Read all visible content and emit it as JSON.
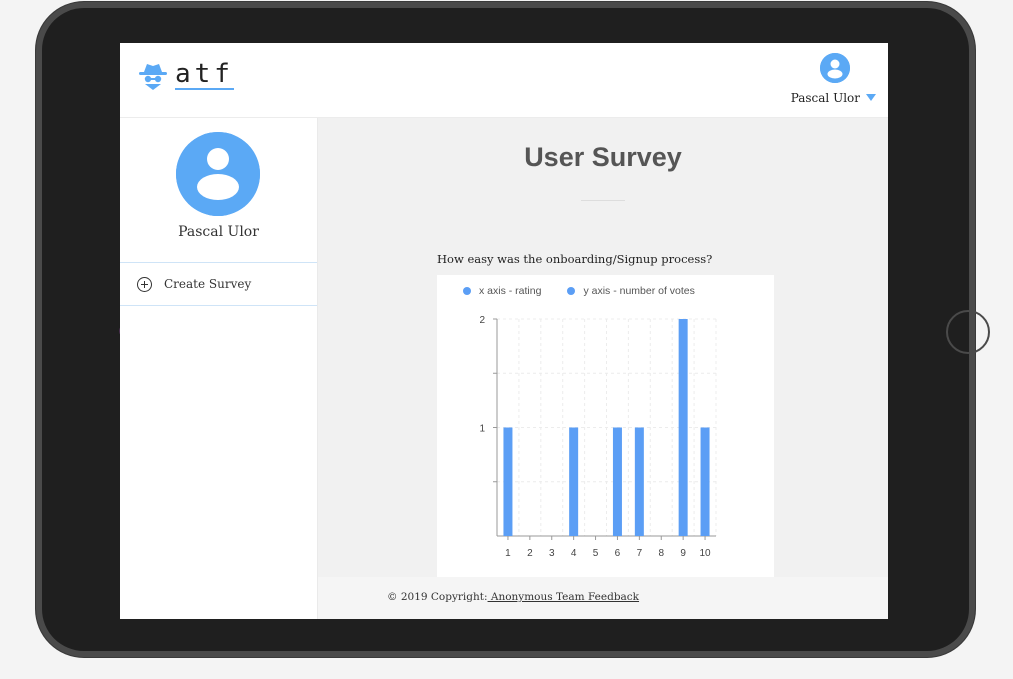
{
  "app": {
    "logo_text": "atf",
    "user_name": "Pascal Ulor"
  },
  "sidebar": {
    "user_name": "Pascal Ulor",
    "items": [
      {
        "label": "Create Survey",
        "icon": "plus-circle-icon"
      }
    ]
  },
  "main": {
    "title": "User Survey",
    "question": "How easy was the onboarding/Signup process?"
  },
  "chart_data": {
    "type": "bar",
    "legend": [
      "x axis - rating",
      "y axis - number of votes"
    ],
    "categories": [
      "1",
      "2",
      "3",
      "4",
      "5",
      "6",
      "7",
      "8",
      "9",
      "10"
    ],
    "values": [
      1,
      0,
      0,
      1,
      0,
      1,
      1,
      0,
      2,
      1
    ],
    "ylim": [
      0,
      2
    ],
    "yticks": [
      "1",
      "2"
    ],
    "grid": true,
    "legend_position": "top-left",
    "bar_color": "#5b9ef5"
  },
  "footer": {
    "prefix": "© 2019 Copyright:",
    "link": " Anonymous Team Feedback"
  },
  "colors": {
    "accent": "#5ba9f5",
    "bezel": "#1f1f1f"
  }
}
